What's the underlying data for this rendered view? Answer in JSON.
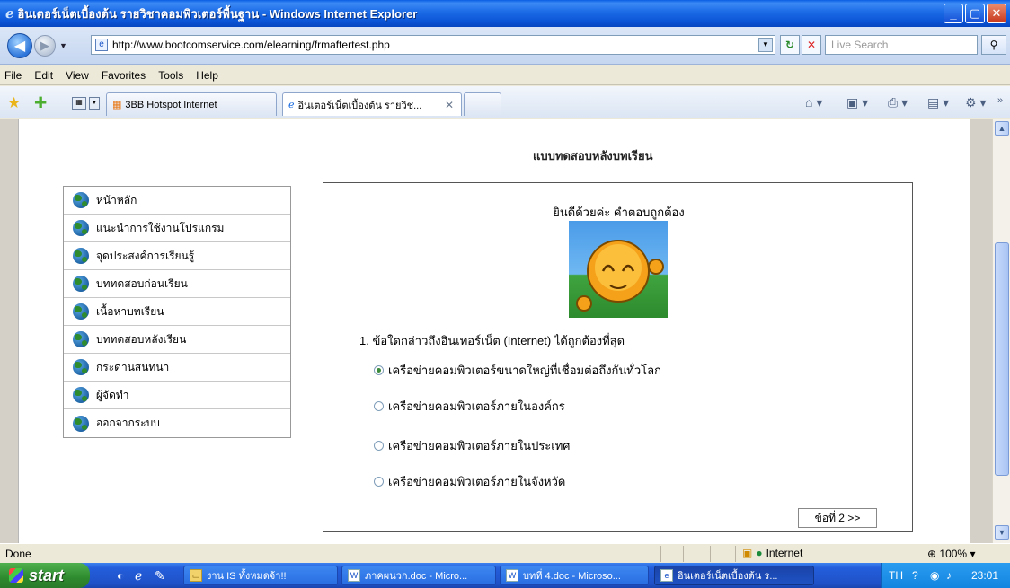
{
  "window": {
    "title": "อินเตอร์เน็ตเบื้องต้น รายวิชาคอมพิวเตอร์พื้นฐาน - Windows Internet Explorer",
    "min": "_",
    "max": "▢",
    "close": "✕"
  },
  "address": {
    "url": "http://www.bootcomservice.com/elearning/frmaftertest.php",
    "search_placeholder": "Live Search"
  },
  "menu": [
    "File",
    "Edit",
    "View",
    "Favorites",
    "Tools",
    "Help"
  ],
  "tabs": [
    {
      "label": "3BB Hotspot Internet"
    },
    {
      "label": "อินเตอร์เน็ตเบื้องต้น รายวิช..."
    }
  ],
  "page": {
    "heading": "แบบทดสอบหลังบทเรียน",
    "nav": [
      "หน้าหลัก",
      "แนะนำการใช้งานโปรแกรม",
      "จุดประสงค์การเรียนรู้",
      "บททดสอบก่อนเรียน",
      "เนื้อหาบทเรียน",
      "บททดสอบหลังเรียน",
      "กระดานสนทนา",
      "ผู้จัดทำ",
      "ออกจากระบบ"
    ],
    "feedback": "ยินดีด้วยค่ะ คำตอบถูกต้อง",
    "question": "1. ข้อใดกล่าวถึงอินเทอร์เน็ต (Internet) ได้ถูกต้องที่สุด",
    "choices": [
      {
        "label": "เครือข่ายคอมพิวเตอร์ขนาดใหญ่ที่เชื่อมต่อถึงกันทั่วโลก",
        "selected": true
      },
      {
        "label": "เครือข่ายคอมพิวเตอร์ภายในองค์กร",
        "selected": false
      },
      {
        "label": "เครือข่ายคอมพิวเตอร์ภายในประเทศ",
        "selected": false
      },
      {
        "label": "เครือข่ายคอมพิวเตอร์ภายในจังหวัด",
        "selected": false
      }
    ],
    "next_button": "ข้อที่ 2 >>"
  },
  "status": {
    "text": "Done",
    "zone": "Internet",
    "zoom": "100%"
  },
  "taskbar": {
    "start": "start",
    "buttons": [
      "งาน IS ทั้งหมดจ้า!!",
      "ภาคผนวก.doc - Micro...",
      "บทที่ 4.doc - Microso...",
      "อินเตอร์เน็ตเบื้องต้น ร..."
    ],
    "lang": "TH",
    "clock": "23:01"
  },
  "colors": {
    "titlebar": "#0a54d6",
    "taskbar": "#245edb",
    "start_green": "#2e8a2e"
  }
}
